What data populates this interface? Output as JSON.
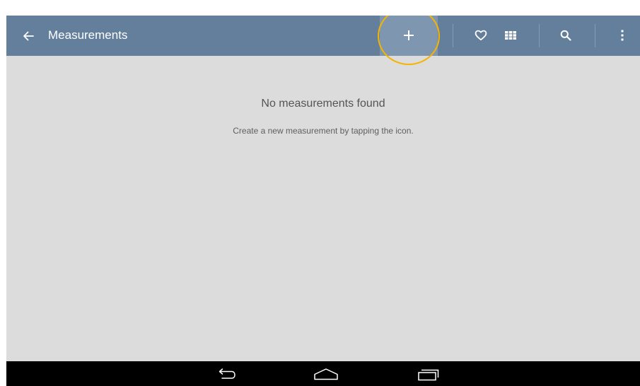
{
  "app_bar": {
    "title": "Measurements",
    "background": "#647f9c",
    "highlight_color": "#f4b400",
    "back_icon": "arrow-left-icon",
    "actions": [
      {
        "name": "add-measurement-button",
        "icon": "plus-icon",
        "highlighted": true
      },
      {
        "name": "favorites-button",
        "icon": "heart-outline-icon"
      },
      {
        "name": "grid-view-button",
        "icon": "grid-icon"
      },
      {
        "name": "search-button",
        "icon": "search-icon"
      },
      {
        "name": "overflow-menu-button",
        "icon": "more-vertical-icon"
      }
    ]
  },
  "empty_state": {
    "title": "No measurements found",
    "hint": "Create a new measurement by tapping the icon."
  },
  "system_nav": {
    "buttons": [
      {
        "name": "nav-back-button",
        "icon": "back-icon"
      },
      {
        "name": "nav-home-button",
        "icon": "home-icon"
      },
      {
        "name": "nav-recents-button",
        "icon": "recents-icon"
      }
    ]
  }
}
